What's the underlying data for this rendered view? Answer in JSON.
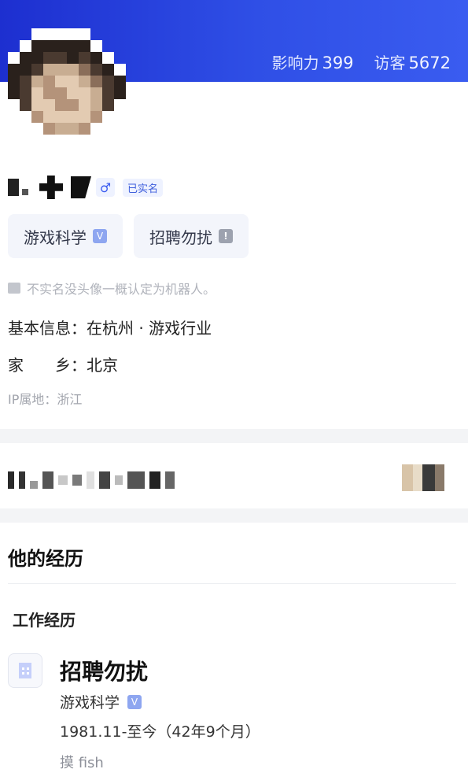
{
  "header": {
    "influence_label": "影响力",
    "influence_value": "399",
    "visitors_label": "访客",
    "visitors_value": "5672",
    "gradient_start": "#1d2fd0",
    "gradient_end": "#3a5cf0"
  },
  "profile": {
    "gender_symbol": "♂",
    "verified_label": "已实名",
    "chips": [
      {
        "label": "游戏科学",
        "badge": "V"
      },
      {
        "label": "招聘勿扰",
        "badge": "!"
      }
    ],
    "tip": "不实名没头像一概认定为机器人。",
    "basic_info": "基本信息：在杭州 · 游戏行业",
    "hometown": "家　　乡：北京",
    "ip_location": "IP属地：浙江"
  },
  "experience": {
    "section_title": "他的经历",
    "work_title": "工作经历",
    "item": {
      "title": "招聘勿扰",
      "company": "游戏科学",
      "company_badge": "V",
      "period": "1981.11-至今（42年9个月）",
      "description": "摸 fish"
    }
  },
  "icons": {
    "gender": "male-icon",
    "tip": "thumbs-up-icon",
    "company": "building-icon"
  },
  "colors": {
    "accent": "#3b5cf0",
    "chip_bg": "#f3f5fb",
    "muted_text": "#a2a5ad"
  }
}
